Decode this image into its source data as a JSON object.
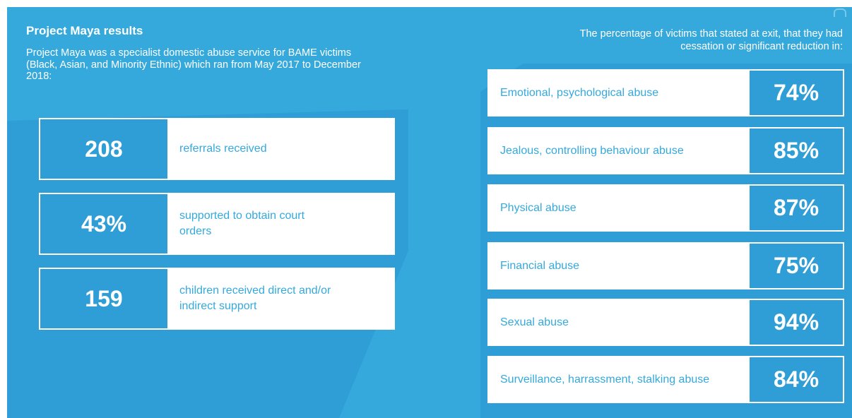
{
  "left": {
    "title": "Project Maya results",
    "intro": "Project Maya was a specialist domestic abuse service for BAME victims (Black, Asian, and Minority Ethnic) which ran from May 2017 to December 2018:",
    "stats": [
      {
        "value": "208",
        "label": "referrals received"
      },
      {
        "value": "43%",
        "label": "supported to obtain court orders"
      },
      {
        "value": "159",
        "label": "children received direct and/or indirect support"
      }
    ]
  },
  "right": {
    "heading": "The percentage of victims that stated at exit, that they had cessation or significant reduction in:",
    "rows": [
      {
        "label": "Emotional, psychological abuse",
        "value": "74%"
      },
      {
        "label": "Jealous, controlling behaviour abuse",
        "value": "85%"
      },
      {
        "label": "Physical abuse",
        "value": "87%"
      },
      {
        "label": "Financial abuse",
        "value": "75%"
      },
      {
        "label": "Sexual abuse",
        "value": "94%"
      },
      {
        "label": "Surveillance, harrassment, stalking abuse",
        "value": "84%"
      }
    ]
  },
  "colors": {
    "background": "#35a9dc",
    "accent_dark": "#2f9ed6",
    "card": "#ffffff"
  }
}
